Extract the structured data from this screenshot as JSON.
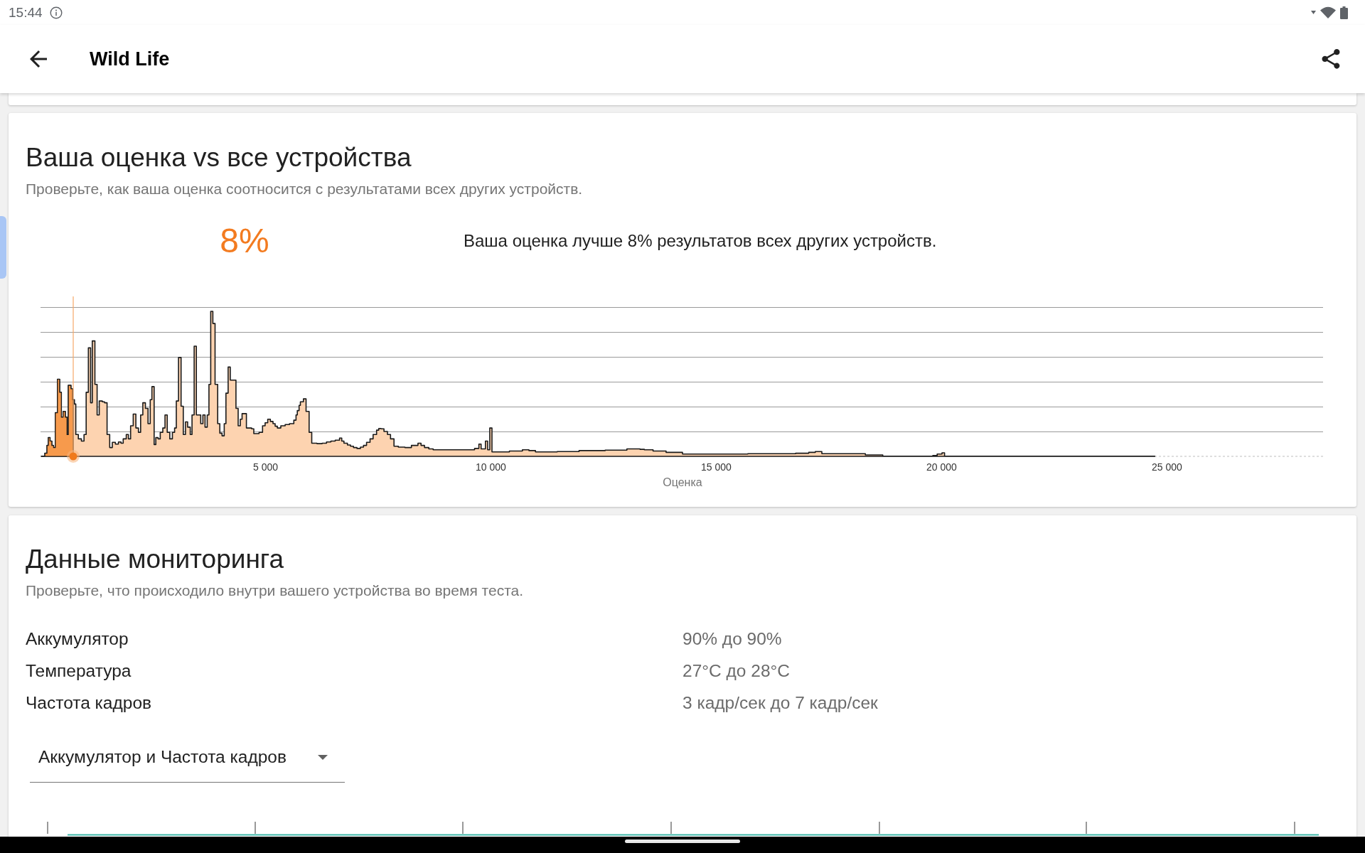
{
  "status_bar": {
    "time": "15:44"
  },
  "app_bar": {
    "title": "Wild Life"
  },
  "score_card": {
    "title": "Ваша оценка vs все устройства",
    "subtitle": "Проверьте, как ваша оценка соотносится с результатами всех других устройств.",
    "percentile": "8%",
    "summary": "Ваша оценка лучше 8% результатов всех других устройств.",
    "histogram": {
      "x_tick_labels": [
        "5 000",
        "10 000",
        "15 000",
        "20 000",
        "25 000"
      ],
      "x_axis_label": "Оценка"
    }
  },
  "monitoring_card": {
    "title": "Данные мониторинга",
    "subtitle": "Проверьте, что происходило внутри вашего устройства во время теста.",
    "rows": [
      {
        "label": "Аккумулятор",
        "value": "90% до 90%"
      },
      {
        "label": "Температура",
        "value": "27°C до 28°C"
      },
      {
        "label": "Частота кадров",
        "value": "3 кадр/сек до 7 кадр/сек"
      }
    ],
    "chart_select": {
      "value": "Аккумулятор и Частота кадров"
    }
  }
}
